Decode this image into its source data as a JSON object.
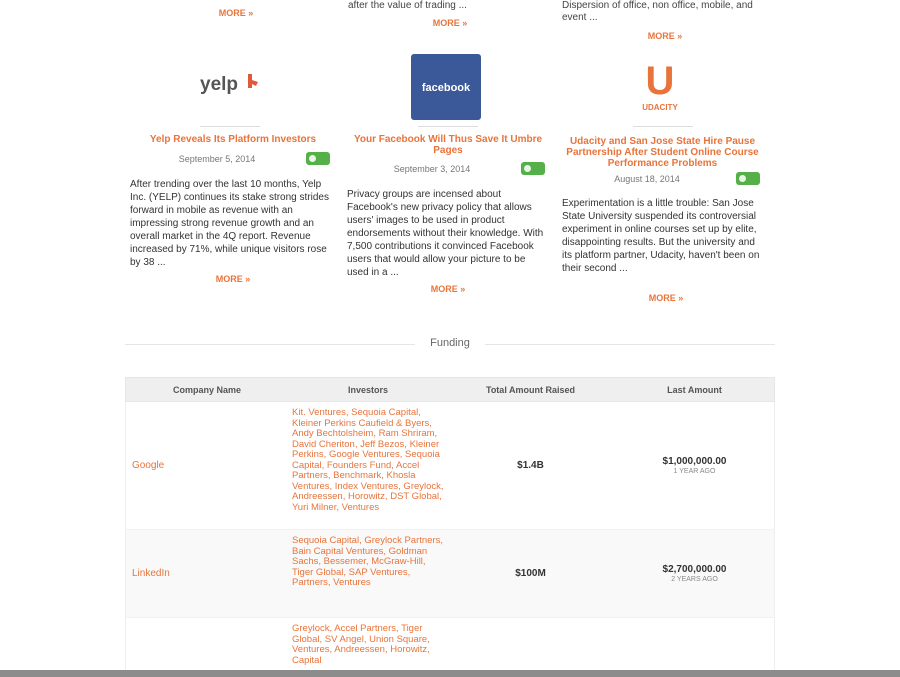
{
  "top_row": {
    "col1_more": "MORE »",
    "col2_snippet": "after the value of trading ...",
    "col2_more": "MORE »",
    "col3_snippet": "Dispersion of office, non office, mobile, and event ...",
    "col3_more": "MORE »"
  },
  "cards": [
    {
      "logo_text": "yelp",
      "title": "Yelp Reveals Its Platform Investors",
      "date": "September 5, 2014",
      "body": "After trending over the last 10 months, Yelp Inc. (YELP) continues its stake strong strides forward in mobile as revenue with an impressing strong revenue growth and an overall market in the 4Q report. Revenue increased by 71%, while unique visitors rose by 38 ...",
      "more": "MORE »"
    },
    {
      "logo_text": "facebook",
      "title": "Your Facebook Will Thus Save It Umbre Pages",
      "date": "September 3, 2014",
      "body": "Privacy groups are incensed about Facebook's new privacy policy that allows users' images to be used in product endorsements without their knowledge. With 7,500 contributions it convinced Facebook users that would allow your picture to be used in a ...",
      "more": "MORE »"
    },
    {
      "logo_text": "U",
      "logo_sub": "UDACITY",
      "title": "Udacity and San Jose State Hire Pause Partnership After Student Online Course Performance Problems",
      "date": "August 18, 2014",
      "body": "Experimentation is a little trouble: San Jose State University suspended its controversial experiment in online courses set up by elite, disappointing results. But the university and its platform partner, Udacity, haven't been on their second ...",
      "more": "MORE »"
    }
  ],
  "funding_title": "Funding",
  "table": {
    "headers": [
      "Company Name",
      "Investors",
      "Total Amount Raised",
      "Last Amount"
    ],
    "rows": [
      {
        "company": "Google",
        "investors": "Kit. Ventures, Sequoia Capital, Kleiner Perkins Caufield & Byers, Andy Bechtolsheim, Ram Shriram, David Cheriton, Jeff Bezos, Kleiner Perkins, Google Ventures, Sequoia Capital, Founders Fund, Accel Partners, Benchmark, Khosla Ventures, Index Ventures, Greylock, Andreessen, Horowitz, DST Global, Yuri Milner, Ventures",
        "total": "$1.4B",
        "last": "$1,000,000.00",
        "last_sub": "1 YEAR AGO"
      },
      {
        "company": "LinkedIn",
        "investors": "Sequoia Capital, Greylock Partners, Bain Capital Ventures, Goldman Sachs, Bessemer, McGraw-Hill, Tiger Global, SAP Ventures, Partners, Ventures",
        "total": "$100M",
        "last": "$2,700,000.00",
        "last_sub": "2 YEARS AGO"
      },
      {
        "company": "",
        "investors": "Greylock, Accel Partners, Tiger Global, SV Angel, Union Square, Ventures, Andreessen, Horowitz, Capital",
        "total": "",
        "last": "",
        "last_sub": ""
      }
    ]
  },
  "colors": {
    "accent": "#e8743b",
    "facebook_blue": "#3b5998",
    "badge_green": "#56b04a",
    "footer_bar": "#8c8c8c"
  }
}
